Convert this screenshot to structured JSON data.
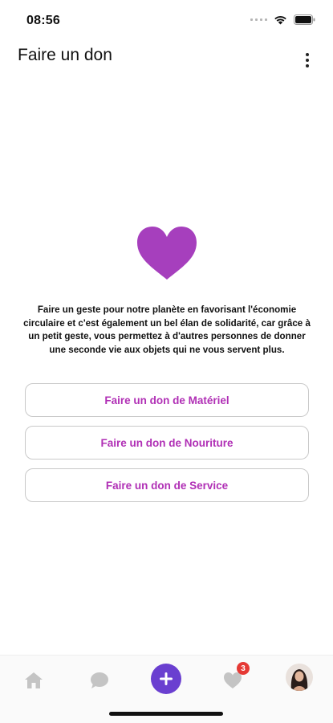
{
  "status_bar": {
    "time": "08:56"
  },
  "app_bar": {
    "title": "Faire un don"
  },
  "main": {
    "description": "Faire un geste pour notre planète en favorisant l'économie circulaire et c'est également un bel élan de solidarité, car grâce à un petit geste, vous permettez à d'autres personnes de donner une seconde vie aux objets qui ne vous servent plus.",
    "buttons": [
      {
        "label": "Faire un don de Matériel"
      },
      {
        "label": "Faire un don de Nouriture"
      },
      {
        "label": "Faire un don de Service"
      }
    ]
  },
  "bottom_nav": {
    "favorites_badge": "3",
    "icons": [
      "home-icon",
      "chat-icon",
      "plus-icon",
      "heart-icon",
      "avatar"
    ]
  },
  "colors": {
    "accent": "#b02fb5",
    "heart": "#a63fbd",
    "add_button": "#6a3fd0",
    "badge": "#e53935"
  }
}
